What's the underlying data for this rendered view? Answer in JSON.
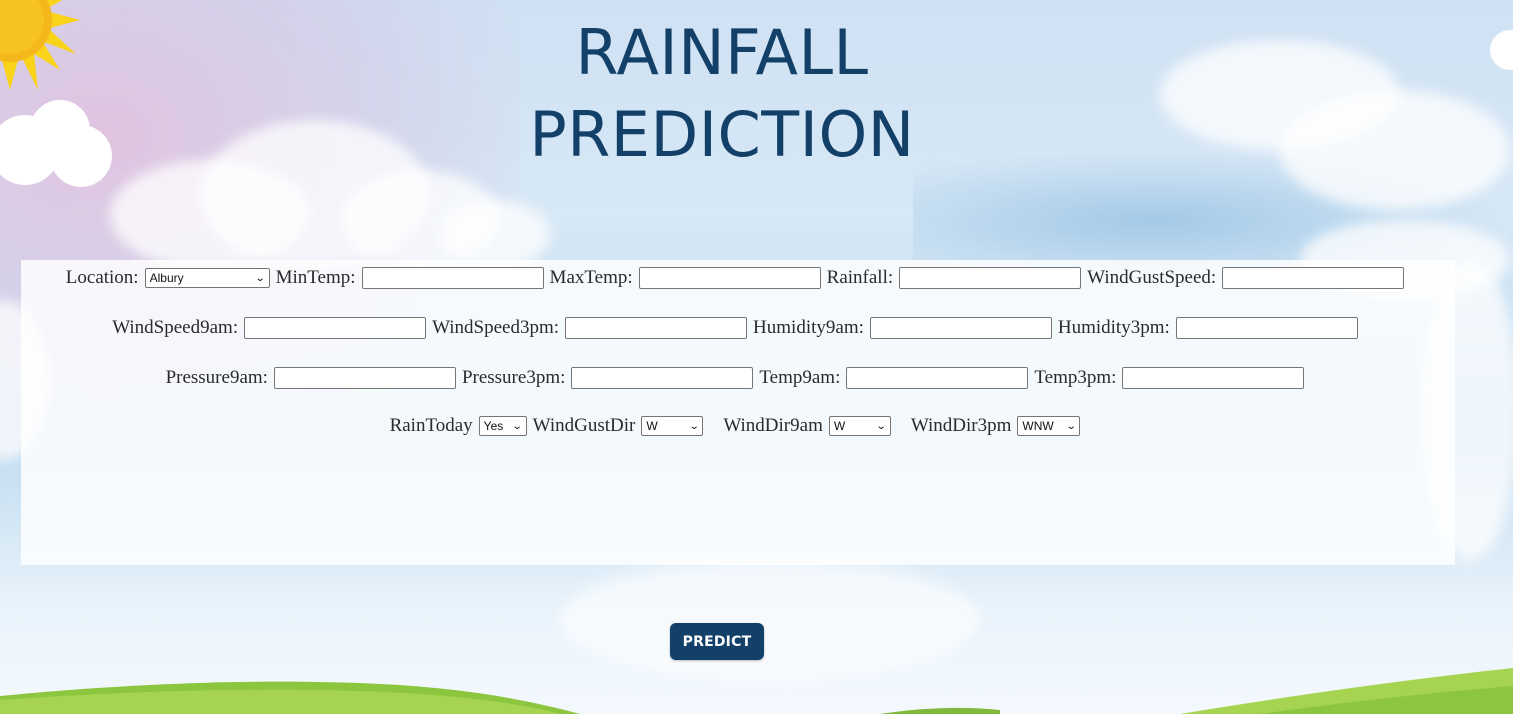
{
  "page": {
    "title_line1": "RAINFALL",
    "title_line2": "PREDICTION"
  },
  "colors": {
    "title": "#124068",
    "button_bg": "#124068",
    "button_text": "#ffffff",
    "panel_bg": "#ffffff"
  },
  "form": {
    "location": {
      "label": "Location:",
      "selected": "Albury"
    },
    "min_temp": {
      "label": "MinTemp:",
      "value": ""
    },
    "max_temp": {
      "label": "MaxTemp:",
      "value": ""
    },
    "rainfall": {
      "label": "Rainfall:",
      "value": ""
    },
    "wind_gust_speed": {
      "label": "WindGustSpeed:",
      "value": ""
    },
    "wind_speed_9am": {
      "label": "WindSpeed9am:",
      "value": ""
    },
    "wind_speed_3pm": {
      "label": "WindSpeed3pm:",
      "value": ""
    },
    "humidity_9am": {
      "label": "Humidity9am:",
      "value": ""
    },
    "humidity_3pm": {
      "label": "Humidity3pm:",
      "value": ""
    },
    "pressure_9am": {
      "label": "Pressure9am:",
      "value": ""
    },
    "pressure_3pm": {
      "label": "Pressure3pm:",
      "value": ""
    },
    "temp_9am": {
      "label": "Temp9am:",
      "value": ""
    },
    "temp_3pm": {
      "label": "Temp3pm:",
      "value": ""
    },
    "rain_today": {
      "label": "RainToday",
      "selected": "Yes"
    },
    "wind_gust_dir": {
      "label": "WindGustDir",
      "selected": "W"
    },
    "wind_dir_9am": {
      "label": "WindDir9am",
      "selected": "W"
    },
    "wind_dir_3pm": {
      "label": "WindDir3pm",
      "selected": "WNW"
    }
  },
  "actions": {
    "predict_label": "PREDICT"
  },
  "icons": {
    "dropdown": "chevron-down-icon",
    "sun": "sun-icon"
  }
}
